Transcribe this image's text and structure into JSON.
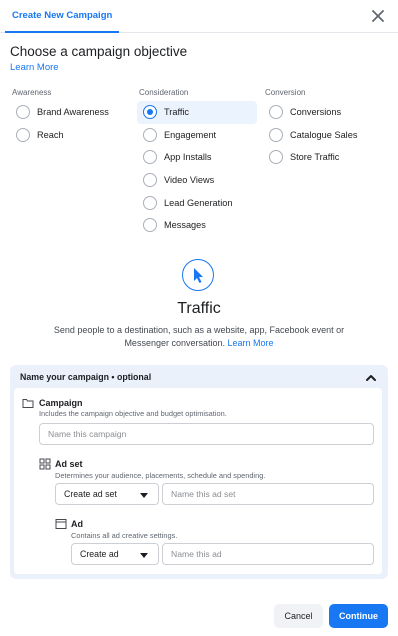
{
  "tab": {
    "label": "Create New Campaign"
  },
  "heading": "Choose a campaign objective",
  "learn_more": "Learn More",
  "columns": [
    {
      "title": "Awareness",
      "options": [
        "Brand Awareness",
        "Reach"
      ]
    },
    {
      "title": "Consideration",
      "options": [
        "Traffic",
        "Engagement",
        "App Installs",
        "Video Views",
        "Lead Generation",
        "Messages"
      ]
    },
    {
      "title": "Conversion",
      "options": [
        "Conversions",
        "Catalogue Sales",
        "Store Traffic"
      ]
    }
  ],
  "selected_option": "Traffic",
  "objective": {
    "title": "Traffic",
    "description": "Send people to a destination, such as a website, app, Facebook event or Messenger conversation.",
    "link": "Learn More"
  },
  "naming": {
    "heading": "Name your campaign • optional",
    "campaign": {
      "title": "Campaign",
      "subtitle": "Includes the campaign objective and budget optimisation.",
      "placeholder": "Name this campaign"
    },
    "ad_set": {
      "title": "Ad set",
      "subtitle": "Determines your audience, placements, schedule and spending.",
      "select": "Create ad set",
      "placeholder": "Name this ad set"
    },
    "ad": {
      "title": "Ad",
      "subtitle": "Contains all ad creative settings.",
      "select": "Create ad",
      "placeholder": "Name this ad"
    }
  },
  "footer": {
    "cancel": "Cancel",
    "continue": "Continue"
  },
  "colors": {
    "accent": "#1877f2",
    "panel": "#ebf1fb",
    "selected_bg": "#ebf3fe"
  },
  "icons": [
    "close-icon",
    "cursor-icon",
    "chevron-up-icon",
    "folder-icon",
    "grid-icon",
    "ad-window-icon",
    "caret-down-icon"
  ]
}
